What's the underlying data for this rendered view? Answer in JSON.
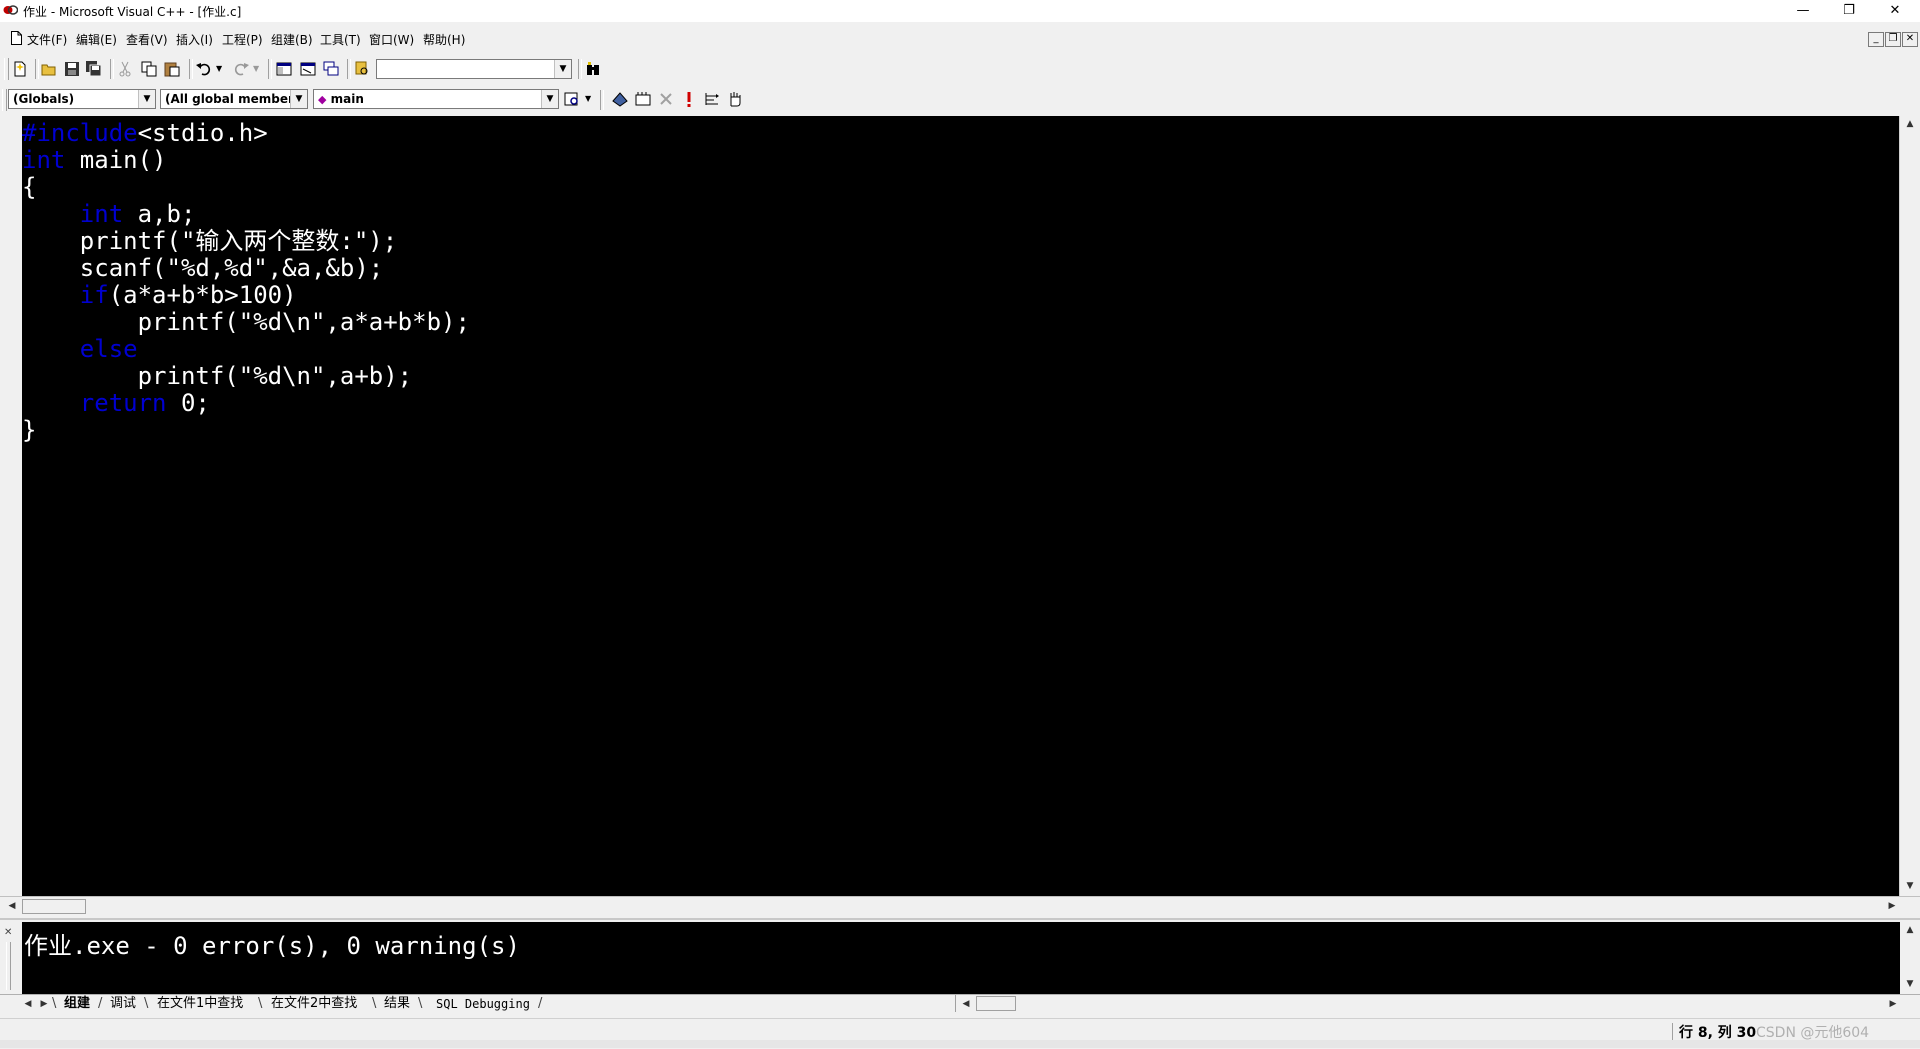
{
  "window": {
    "title": "作业 - Microsoft Visual C++ - [作业.c]",
    "minimize": "—",
    "restore": "❐",
    "close": "✕"
  },
  "menu": {
    "items": [
      "文件(F)",
      "编辑(E)",
      "查看(V)",
      "插入(I)",
      "工程(P)",
      "组建(B)",
      "工具(T)",
      "窗口(W)",
      "帮助(H)"
    ],
    "mdi_minimize": "_",
    "mdi_restore": "❐",
    "mdi_close": "✕"
  },
  "toolbar": {
    "find_combo_value": "",
    "class_combo": "(Globals)",
    "members_combo": "(All global members",
    "function_combo": "main",
    "function_icon": "method-diamond-icon"
  },
  "editor": {
    "lines": [
      [
        {
          "t": "#include",
          "k": true
        },
        {
          "t": "<stdio.h>"
        }
      ],
      [
        {
          "t": "int",
          "k": true
        },
        {
          "t": " main()"
        }
      ],
      [
        {
          "t": "{"
        }
      ],
      [
        {
          "t": "    "
        },
        {
          "t": "int",
          "k": true
        },
        {
          "t": " a,b;"
        }
      ],
      [
        {
          "t": "    printf(\"输入两个整数:\");"
        }
      ],
      [
        {
          "t": "    scanf(\"%d,%d\",&a,&b);"
        }
      ],
      [
        {
          "t": "    "
        },
        {
          "t": "if",
          "k": true
        },
        {
          "t": "(a*a+b*b>100)"
        }
      ],
      [
        {
          "t": "        printf(\"%d\\n\",a*a+b*b);"
        }
      ],
      [
        {
          "t": "    "
        },
        {
          "t": "else",
          "k": true
        }
      ],
      [
        {
          "t": "        printf(\"%d\\n\",a+b);"
        }
      ],
      [
        {
          "t": "    "
        },
        {
          "t": "return",
          "k": true
        },
        {
          "t": " 0;"
        }
      ],
      [
        {
          "t": "}"
        }
      ]
    ],
    "keyword_color": "#0000d0",
    "text_color": "#ffffff",
    "background": "#000000"
  },
  "output": {
    "text": "作业.exe - 0 error(s), 0 warning(s)",
    "tabs": [
      "组建",
      "调试",
      "在文件1中查找",
      "在文件2中查找",
      "结果",
      "SQL Debugging"
    ],
    "active_tab": "组建"
  },
  "status": {
    "position": "行 8, 列 30",
    "watermark": "CSDN @元他604"
  }
}
